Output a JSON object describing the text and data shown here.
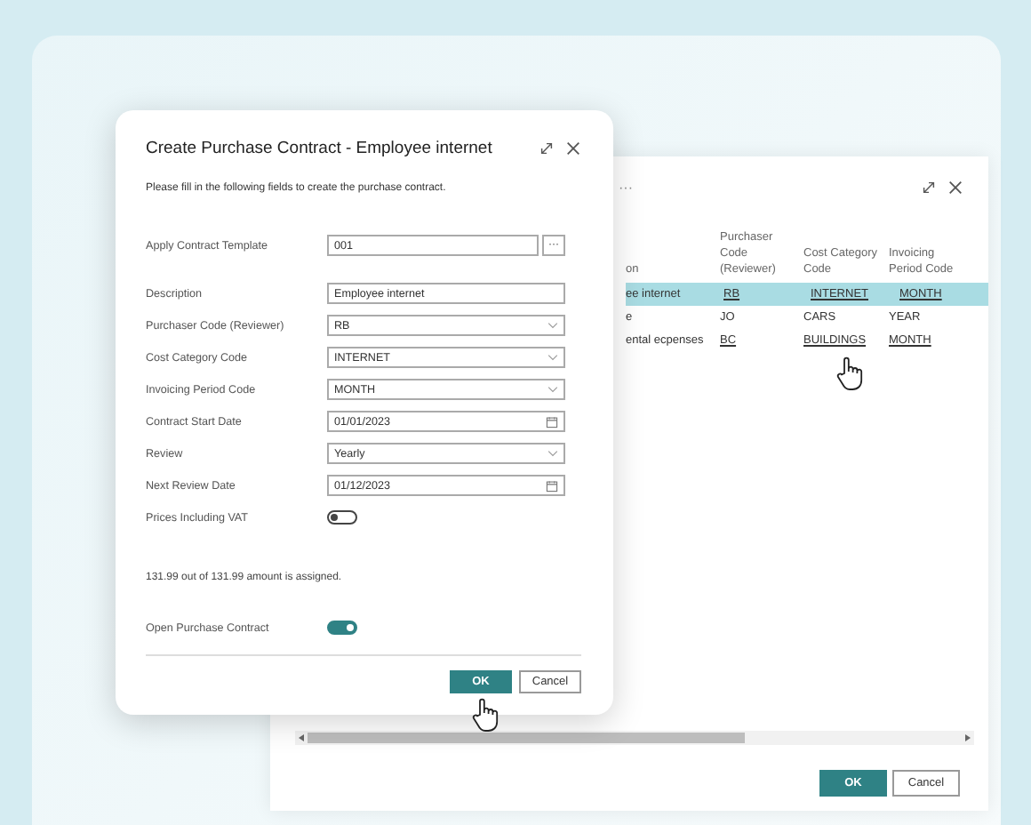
{
  "background_window": {
    "menu": "···",
    "columns": [
      "on",
      "Purchaser Code (Reviewer)",
      "Cost Category Code",
      "Invoicing Period Code"
    ],
    "rows": [
      {
        "selected": true,
        "cells": [
          {
            "text": "ee internet",
            "link": false
          },
          {
            "text": "RB",
            "link": true
          },
          {
            "text": "INTERNET",
            "link": true
          },
          {
            "text": "MONTH",
            "link": true
          }
        ]
      },
      {
        "selected": false,
        "cells": [
          {
            "text": "e",
            "link": false
          },
          {
            "text": "JO",
            "link": false
          },
          {
            "text": "CARS",
            "link": false
          },
          {
            "text": "YEAR",
            "link": false
          }
        ]
      },
      {
        "selected": false,
        "cells": [
          {
            "text": "ental ecpenses",
            "link": false
          },
          {
            "text": "BC",
            "link": true
          },
          {
            "text": "BUILDINGS",
            "link": true
          },
          {
            "text": "MONTH",
            "link": true
          }
        ]
      }
    ],
    "buttons": [
      {
        "label": "OK",
        "kind": "primary"
      },
      {
        "label": "Cancel",
        "kind": "secondary"
      }
    ]
  },
  "dialog": {
    "title": "Create Purchase Contract - Employee internet",
    "instructions": "Please fill in the following fields to create the purchase contract.",
    "template_field": {
      "label": "Apply Contract Template",
      "value": "001",
      "lookup": "···"
    },
    "fields": [
      {
        "label": "Description",
        "value": "Employee internet",
        "kind": "text"
      },
      {
        "label": "Purchaser Code (Reviewer)",
        "value": "RB",
        "kind": "dropdown"
      },
      {
        "label": "Cost Category Code",
        "value": "INTERNET",
        "kind": "dropdown"
      },
      {
        "label": "Invoicing Period Code",
        "value": "MONTH",
        "kind": "dropdown"
      },
      {
        "label": "Contract Start Date",
        "value": "01/01/2023",
        "kind": "date"
      },
      {
        "label": "Review",
        "value": "Yearly",
        "kind": "dropdown"
      },
      {
        "label": "Next Review Date",
        "value": "01/12/2023",
        "kind": "date"
      },
      {
        "label": "Prices Including VAT",
        "kind": "toggle",
        "on": false
      }
    ],
    "assigned_note": "131.99 out of 131.99 amount is assigned.",
    "open_toggle": {
      "label": "Open Purchase Contract",
      "on": true
    },
    "buttons": [
      {
        "label": "OK",
        "kind": "primary"
      },
      {
        "label": "Cancel",
        "kind": "secondary"
      }
    ]
  }
}
